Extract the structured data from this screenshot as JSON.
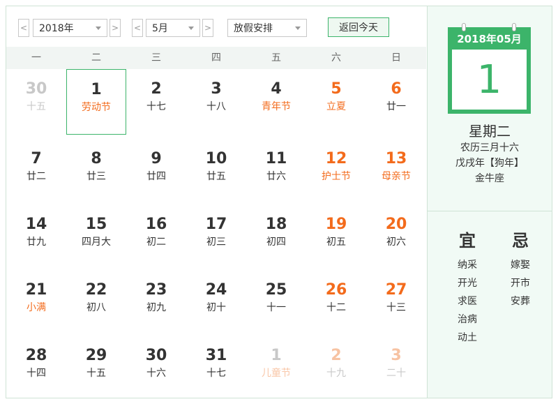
{
  "toolbar": {
    "year": "2018年",
    "month": "5月",
    "holiday": "放假安排",
    "today_button": "返回今天"
  },
  "weekdays": [
    "一",
    "二",
    "三",
    "四",
    "五",
    "六",
    "日"
  ],
  "weeks": [
    [
      {
        "day": "30",
        "lunar": "十五",
        "other": true
      },
      {
        "day": "1",
        "lunar": "劳动节",
        "festival": true,
        "selected": true
      },
      {
        "day": "2",
        "lunar": "十七"
      },
      {
        "day": "3",
        "lunar": "十八"
      },
      {
        "day": "4",
        "lunar": "青年节",
        "festival": true
      },
      {
        "day": "5",
        "lunar": "立夏",
        "festival": true
      },
      {
        "day": "6",
        "lunar": "廿一"
      }
    ],
    [
      {
        "day": "7",
        "lunar": "廿二"
      },
      {
        "day": "8",
        "lunar": "廿三"
      },
      {
        "day": "9",
        "lunar": "廿四"
      },
      {
        "day": "10",
        "lunar": "廿五"
      },
      {
        "day": "11",
        "lunar": "廿六"
      },
      {
        "day": "12",
        "lunar": "护士节",
        "festival": true
      },
      {
        "day": "13",
        "lunar": "母亲节",
        "festival": true
      }
    ],
    [
      {
        "day": "14",
        "lunar": "廿九"
      },
      {
        "day": "15",
        "lunar": "四月大"
      },
      {
        "day": "16",
        "lunar": "初二"
      },
      {
        "day": "17",
        "lunar": "初三"
      },
      {
        "day": "18",
        "lunar": "初四"
      },
      {
        "day": "19",
        "lunar": "初五"
      },
      {
        "day": "20",
        "lunar": "初六"
      }
    ],
    [
      {
        "day": "21",
        "lunar": "小满",
        "festival": true
      },
      {
        "day": "22",
        "lunar": "初八"
      },
      {
        "day": "23",
        "lunar": "初九"
      },
      {
        "day": "24",
        "lunar": "初十"
      },
      {
        "day": "25",
        "lunar": "十一"
      },
      {
        "day": "26",
        "lunar": "十二"
      },
      {
        "day": "27",
        "lunar": "十三"
      }
    ],
    [
      {
        "day": "28",
        "lunar": "十四"
      },
      {
        "day": "29",
        "lunar": "十五"
      },
      {
        "day": "30",
        "lunar": "十六"
      },
      {
        "day": "31",
        "lunar": "十七"
      },
      {
        "day": "1",
        "lunar": "儿童节",
        "festival": true,
        "other": true
      },
      {
        "day": "2",
        "lunar": "十九",
        "other": true
      },
      {
        "day": "3",
        "lunar": "二十",
        "other": true
      }
    ]
  ],
  "side": {
    "card_title": "2018年05月",
    "card_day": "1",
    "weekday": "星期二",
    "lunar_date": "农历三月十六",
    "ganzhi": "戊戌年【狗年】",
    "zodiac": "金牛座",
    "yi_label": "宜",
    "ji_label": "忌",
    "yi": [
      "纳采",
      "开光",
      "求医",
      "治病",
      "动土"
    ],
    "ji": [
      "嫁娶",
      "开市",
      "安葬"
    ]
  },
  "colors": {
    "accent_green": "#3cb46a",
    "weekend_orange": "#f36b1c",
    "panel_bg": "#f1faf5"
  }
}
